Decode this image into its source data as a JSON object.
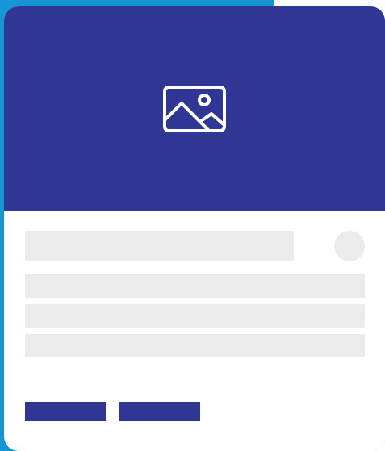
{
  "colors": {
    "backdrop_accent": "#1696d4",
    "card_background": "#ffffff",
    "media_background": "#2f3694",
    "skeleton": "#ebebeb",
    "button": "#2f3694"
  },
  "card": {
    "media": {
      "icon": "image-placeholder-icon"
    },
    "skeleton": {
      "title_placeholder": "",
      "avatar_placeholder": "",
      "text_lines": [
        "",
        "",
        ""
      ]
    },
    "actions": [
      {
        "label": ""
      },
      {
        "label": ""
      }
    ]
  }
}
